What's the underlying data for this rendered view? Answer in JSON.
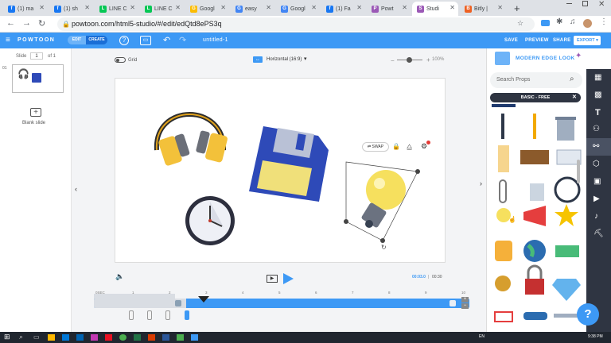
{
  "tabs": [
    {
      "label": "(1) ma",
      "fav": "f",
      "color": "#1877f2"
    },
    {
      "label": "(1) sh",
      "fav": "f",
      "color": "#1877f2"
    },
    {
      "label": "LINE C",
      "fav": "L",
      "color": "#06c755"
    },
    {
      "label": "LINE C",
      "fav": "L",
      "color": "#06c755"
    },
    {
      "label": "Googl",
      "fav": "G",
      "color": "#fbbc04"
    },
    {
      "label": "easy",
      "fav": "G",
      "color": "#4285f4"
    },
    {
      "label": "Googl",
      "fav": "G",
      "color": "#4285f4"
    },
    {
      "label": "(1) Fa",
      "fav": "f",
      "color": "#1877f2"
    },
    {
      "label": "Powt",
      "fav": "P",
      "color": "#9b59b6"
    },
    {
      "label": "Studi",
      "fav": "S",
      "color": "#9b59b6",
      "active": true
    },
    {
      "label": "Bitly |",
      "fav": "B",
      "color": "#ee6123"
    }
  ],
  "browser": {
    "url": "powtoon.com/html5-studio/#/edit/edQtd8ePS3q",
    "new_tab": "+"
  },
  "app": {
    "logo": "POWTOON",
    "edit": "EDIT",
    "create": "CREATE",
    "doc_title": "untitled-1",
    "save": "SAVE",
    "preview": "PREVIEW",
    "share": "SHARE",
    "export": "EXPORT"
  },
  "slides": {
    "slide_label": "Slide",
    "slide_num": "1",
    "of": "of 1",
    "num": "01",
    "blank_label": "Blank slide"
  },
  "toolbar": {
    "grid": "Grid",
    "orientation": "Horizontal (16:9)",
    "zoom": "100%"
  },
  "selection": {
    "swap": "SWAP"
  },
  "player": {
    "time_current": "00:03.0",
    "time_total": "00:30"
  },
  "timeline": {
    "ticks": [
      "0SEC",
      "1",
      "2",
      "3",
      "4",
      "5",
      "6",
      "7",
      "8",
      "9",
      "10"
    ]
  },
  "props": {
    "look": "MODERN EDGE LOOK",
    "search_placeholder": "Search Props",
    "category": "BASIC - FREE"
  },
  "taskbar": {
    "lang": "EN",
    "time": "9:38 PM"
  },
  "colors": {
    "accent": "#3d99f5",
    "topbar": "#3d99f5",
    "category": "#2f3542"
  }
}
